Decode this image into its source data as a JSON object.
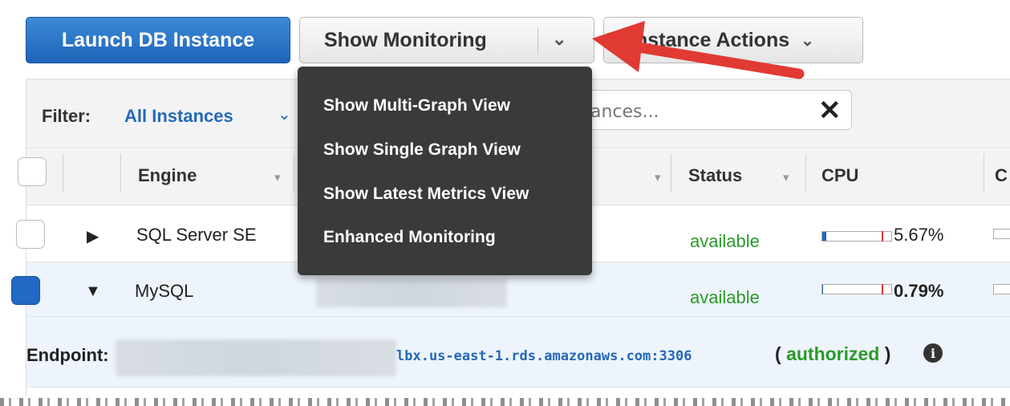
{
  "toolbar": {
    "launch_label": "Launch DB Instance",
    "monitoring_label": "Show Monitoring",
    "actions_label": "Instance Actions"
  },
  "monitoring_menu": {
    "items": [
      {
        "label": "Show Multi-Graph View"
      },
      {
        "label": "Show Single Graph View"
      },
      {
        "label": "Show Latest Metrics View"
      },
      {
        "label": "Enhanced Monitoring"
      }
    ]
  },
  "filter": {
    "label": "Filter:",
    "value": "All Instances",
    "search_visible_text": "ances..."
  },
  "columns": {
    "engine": "Engine",
    "status": "Status",
    "cpu": "CPU",
    "partial": "C"
  },
  "rows": [
    {
      "engine": "SQL Server SE",
      "status": "available",
      "cpu": "5.67%",
      "cpu_fraction": 0.0567,
      "selected": false,
      "expanded": false
    },
    {
      "engine": "MySQL",
      "status": "available",
      "cpu": "0.79%",
      "cpu_fraction": 0.0079,
      "selected": true,
      "expanded": true
    }
  ],
  "detail": {
    "endpoint_label": "Endpoint:",
    "endpoint_url": "lbx.us-east-1.rds.amazonaws.com:3306",
    "authorization": "authorized",
    "paren_open": "(",
    "paren_close": ")"
  },
  "colors": {
    "primary": "#1f63b8",
    "link": "#2468b8",
    "status_green": "#2a9a2a",
    "menu_bg": "#3a3a3a",
    "arrow_red": "#e03a33"
  },
  "icons": {
    "monitoring_caret": "chevron-down-icon",
    "actions_caret": "chevron-down-icon",
    "clear_search": "close-icon",
    "info": "info-icon",
    "expand": "triangle-right-icon",
    "collapse": "triangle-down-icon"
  }
}
